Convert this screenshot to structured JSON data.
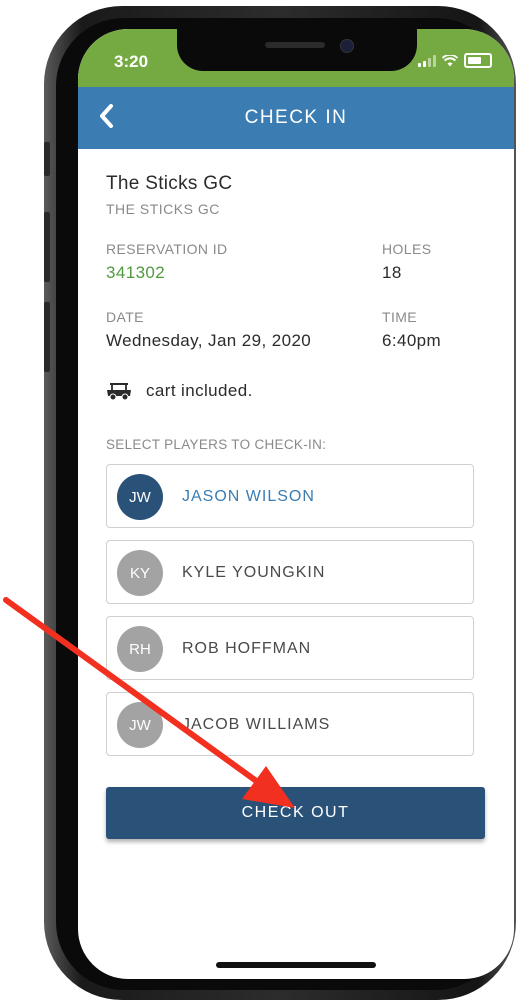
{
  "status_bar": {
    "time": "3:20",
    "color": "#75aa43"
  },
  "nav": {
    "title": "CHECK IN",
    "color": "#3b7db3"
  },
  "course": {
    "name": "The Sticks GC",
    "subtitle": "THE STICKS GC"
  },
  "reservation": {
    "id_label": "RESERVATION ID",
    "id_value": "341302",
    "holes_label": "HOLES",
    "holes_value": "18",
    "date_label": "DATE",
    "date_value": "Wednesday, Jan 29, 2020",
    "time_label": "TIME",
    "time_value": "6:40pm"
  },
  "cart_text": "cart included.",
  "select_label": "SELECT PLAYERS TO CHECK-IN:",
  "players": [
    {
      "initials": "JW",
      "name": "JASON WILSON",
      "selected": true
    },
    {
      "initials": "KY",
      "name": "KYLE YOUNGKIN",
      "selected": false
    },
    {
      "initials": "RH",
      "name": "ROB HOFFMAN",
      "selected": false
    },
    {
      "initials": "JW",
      "name": "JACOB WILLIAMS",
      "selected": false
    }
  ],
  "checkout_label": "CHECK OUT",
  "colors": {
    "accent_dark": "#2a5178",
    "green": "#4f9a3e",
    "annotation_arrow": "#f2301f"
  }
}
